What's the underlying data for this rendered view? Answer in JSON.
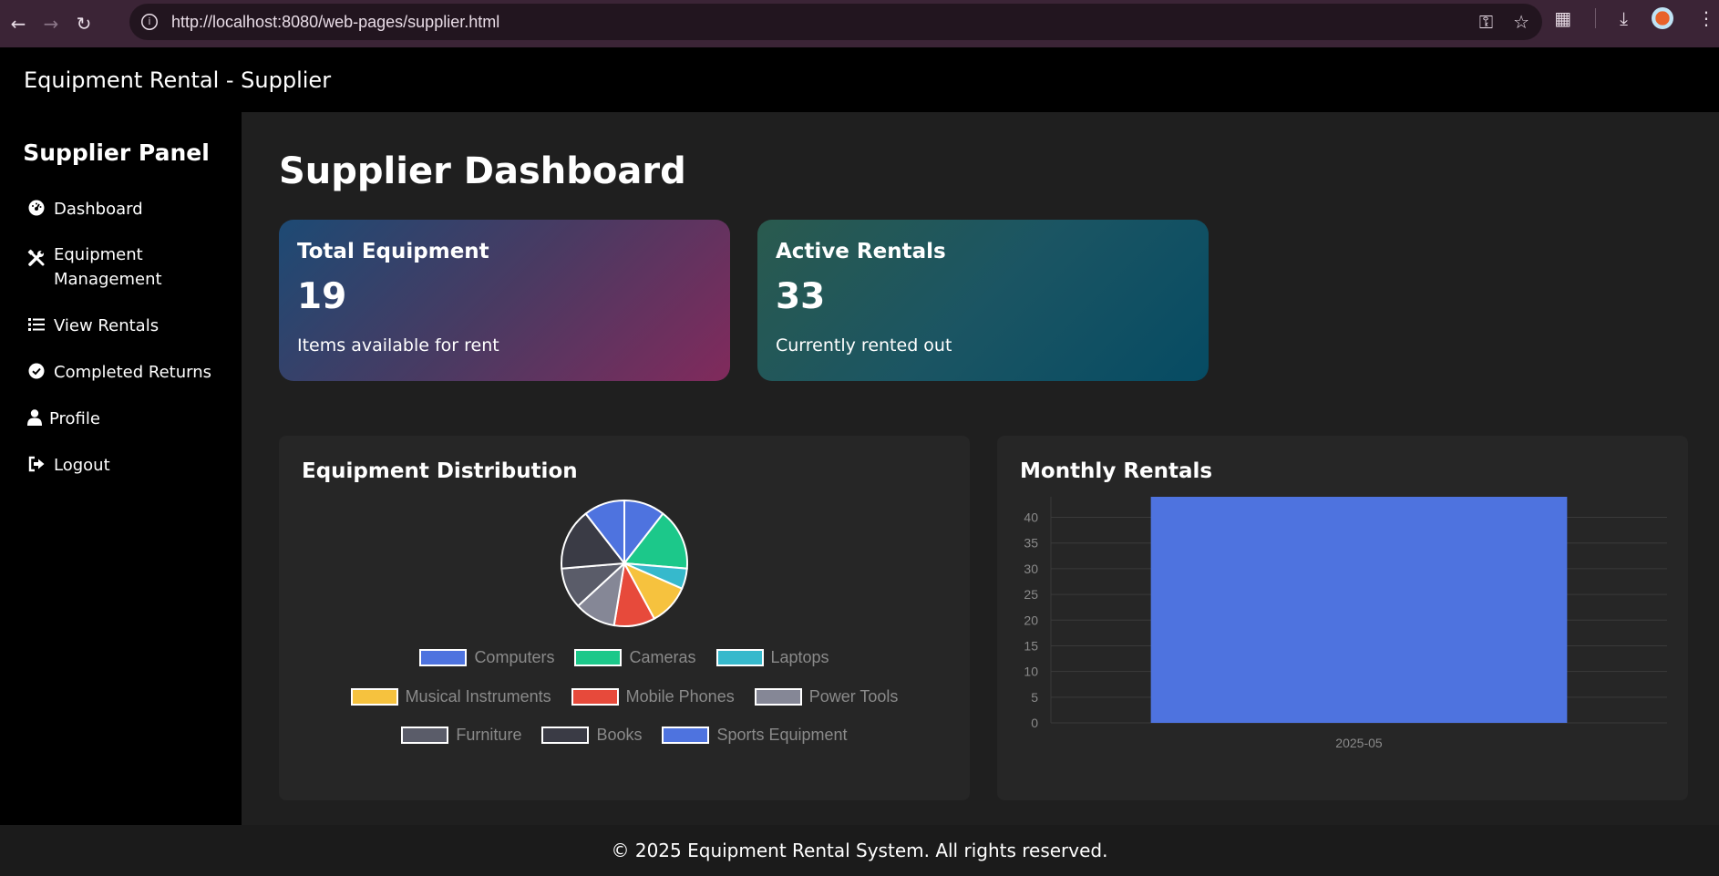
{
  "browser": {
    "url": "http://localhost:8080/web-pages/supplier.html"
  },
  "header": {
    "title": "Equipment Rental - Supplier"
  },
  "sidebar": {
    "title": "Supplier Panel",
    "items": [
      {
        "label": "Dashboard",
        "icon": "gauge-icon"
      },
      {
        "label": "Equipment Management",
        "icon": "tools-icon"
      },
      {
        "label": "View Rentals",
        "icon": "list-icon"
      },
      {
        "label": "Completed Returns",
        "icon": "check-circle-icon"
      },
      {
        "label": "Profile",
        "icon": "user-icon"
      },
      {
        "label": "Logout",
        "icon": "logout-icon"
      }
    ]
  },
  "main": {
    "page_title": "Supplier Dashboard",
    "cards": [
      {
        "title": "Total Equipment",
        "value": "19",
        "desc": "Items available for rent"
      },
      {
        "title": "Active Rentals",
        "value": "33",
        "desc": "Currently rented out"
      }
    ],
    "charts": {
      "distribution_title": "Equipment Distribution",
      "monthly_title": "Monthly Rentals"
    }
  },
  "chart_data": [
    {
      "type": "pie",
      "title": "Equipment Distribution",
      "categories": [
        "Computers",
        "Cameras",
        "Laptops",
        "Musical Instruments",
        "Mobile Phones",
        "Power Tools",
        "Furniture",
        "Books",
        "Sports Equipment"
      ],
      "values": [
        2,
        3,
        1,
        2,
        2,
        2,
        2,
        3,
        2
      ],
      "colors": [
        "#4e73df",
        "#1cc88a",
        "#36b9cc",
        "#f6c23e",
        "#e74a3b",
        "#858796",
        "#5a5c69",
        "#3a3b45",
        "#4e73df"
      ],
      "legend": "bottom"
    },
    {
      "type": "bar",
      "title": "Monthly Rentals",
      "categories": [
        "2025-05"
      ],
      "values": [
        44
      ],
      "ylim": [
        0,
        44
      ],
      "yticks": [
        0,
        5,
        10,
        15,
        20,
        25,
        30,
        35,
        40
      ],
      "color": "#4e73df",
      "grid": true
    }
  ],
  "footer": {
    "text": "© 2025 Equipment Rental System. All rights reserved."
  }
}
